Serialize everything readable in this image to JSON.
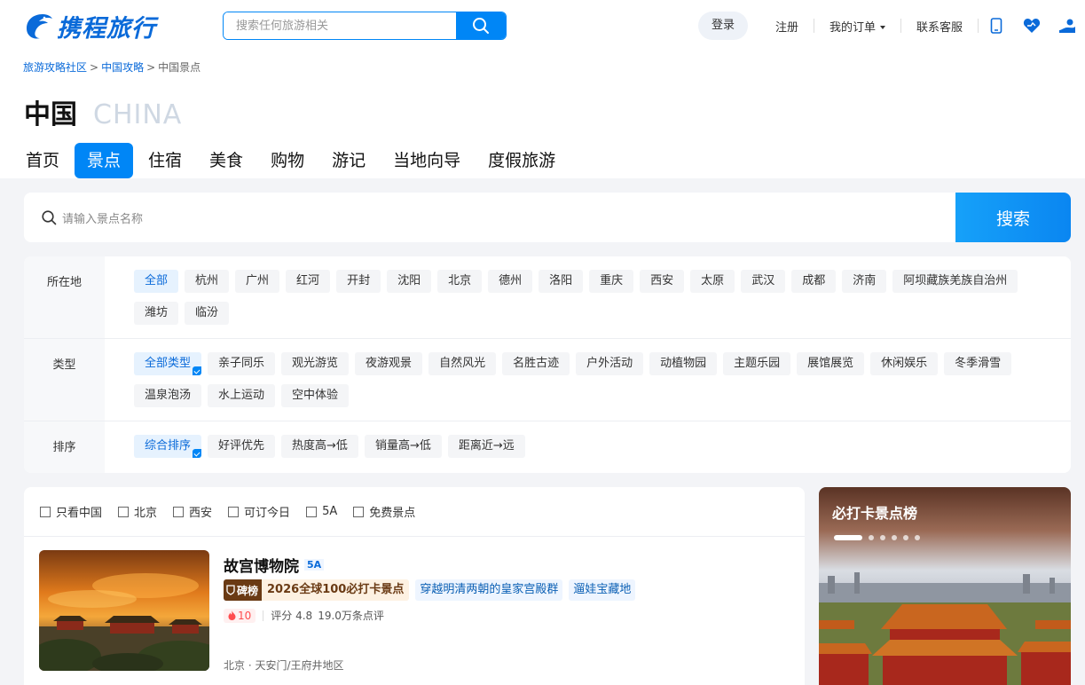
{
  "header": {
    "logo_text": "携程旅行",
    "search_placeholder": "搜索任何旅游相关",
    "login": "登录",
    "register": "注册",
    "orders": "我的订单",
    "service": "联系客服"
  },
  "breadcrumb": [
    "旅游攻略社区",
    "中国攻略",
    "中国景点"
  ],
  "title": {
    "cn": "中国",
    "en": "CHINA"
  },
  "tabs": [
    "首页",
    "景点",
    "住宿",
    "美食",
    "购物",
    "游记",
    "当地向导",
    "度假旅游"
  ],
  "active_tab": "景点",
  "main_search": {
    "placeholder": "请输入景点名称",
    "button": "搜索"
  },
  "filters": {
    "location": {
      "label": "所在地",
      "items": [
        "全部",
        "杭州",
        "广州",
        "红河",
        "开封",
        "沈阳",
        "北京",
        "德州",
        "洛阳",
        "重庆",
        "西安",
        "太原",
        "武汉",
        "成都",
        "济南",
        "阿坝藏族羌族自治州",
        "潍坊",
        "临汾"
      ]
    },
    "type": {
      "label": "类型",
      "items": [
        "全部类型",
        "亲子同乐",
        "观光游览",
        "夜游观景",
        "自然风光",
        "名胜古迹",
        "户外活动",
        "动植物园",
        "主题乐园",
        "展馆展览",
        "休闲娱乐",
        "冬季滑雪",
        "温泉泡汤",
        "水上运动",
        "空中体验"
      ]
    },
    "sort": {
      "label": "排序",
      "items": [
        "综合排序",
        "好评优先",
        "热度高→低",
        "销量高→低",
        "距离近→远"
      ]
    }
  },
  "checkboxes": [
    "只看中国",
    "北京",
    "西安",
    "可订今日",
    "5A",
    "免费景点"
  ],
  "results": [
    {
      "name": "故宫博物院",
      "level": "5A",
      "rank_badge": "碑榜",
      "rank_text": "2026全球100必打卡景点",
      "tags": [
        "穿越明清两朝的皇家宫殿群",
        "遛娃宝藏地"
      ],
      "heat": "10",
      "rating": "评分 4.8",
      "reviews": "19.0万条点评",
      "address": "北京 · 天安门/王府井地区"
    }
  ],
  "side_card": {
    "title": "必打卡景点榜"
  },
  "colors": {
    "brand": "#0086f6",
    "link": "#0a6ad9",
    "rank_dark": "#6a3a14"
  }
}
